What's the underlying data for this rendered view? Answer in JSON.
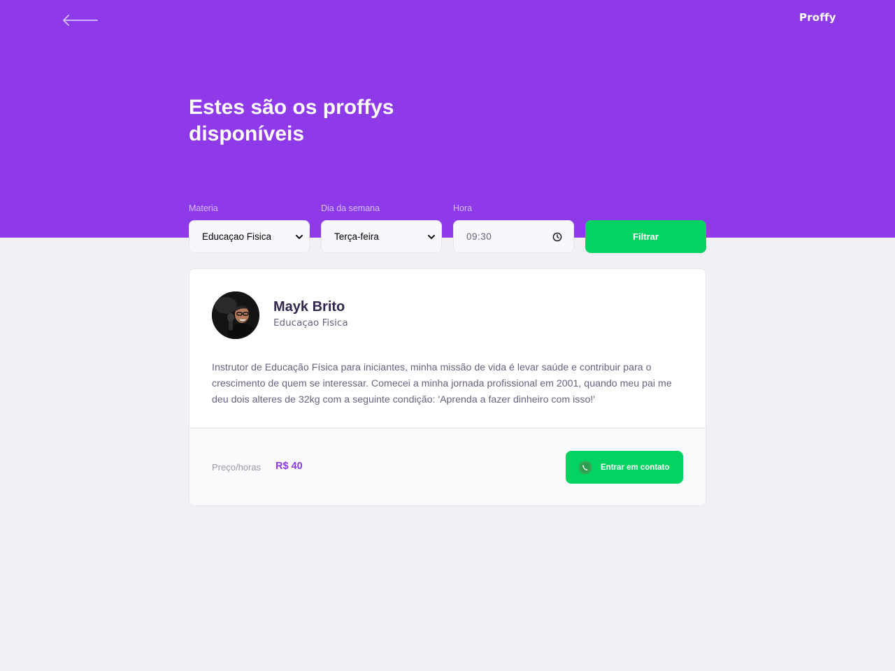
{
  "header": {
    "logo": "Proffy",
    "title": "Estes são os proffys disponíveis"
  },
  "filters": {
    "subject": {
      "label": "Materia",
      "value": "Educaçao Fisica"
    },
    "weekday": {
      "label": "Dia da semana",
      "value": "Terça-feira"
    },
    "time": {
      "label": "Hora",
      "value": "09:30"
    },
    "submit_label": "Filtrar"
  },
  "teacher": {
    "name": "Mayk Brito",
    "subject": "Educaçao Fisica",
    "bio": "Instrutor de Educação Física para iniciantes, minha missão de vida é levar saúde e contribuir para o crescimento de quem se interessar. Comecei a minha jornada profissional em 2001, quando meu pai me deu dois alteres de 32kg com a seguinte condição: 'Aprenda a fazer dinheiro com isso!'",
    "price_label": "Preço/horas",
    "price_value": "R$ 40",
    "contact_label": "Entrar em contato"
  },
  "icons": {
    "back": "arrow-left-icon",
    "select_caret": "chevron-down-icon",
    "time": "clock-icon",
    "contact": "whatsapp-icon"
  },
  "colors": {
    "primary": "#8E3AE8",
    "secondary": "#04D361",
    "background": "#F0F0F7",
    "title_text": "#32264D",
    "body_text": "#6A6180"
  }
}
